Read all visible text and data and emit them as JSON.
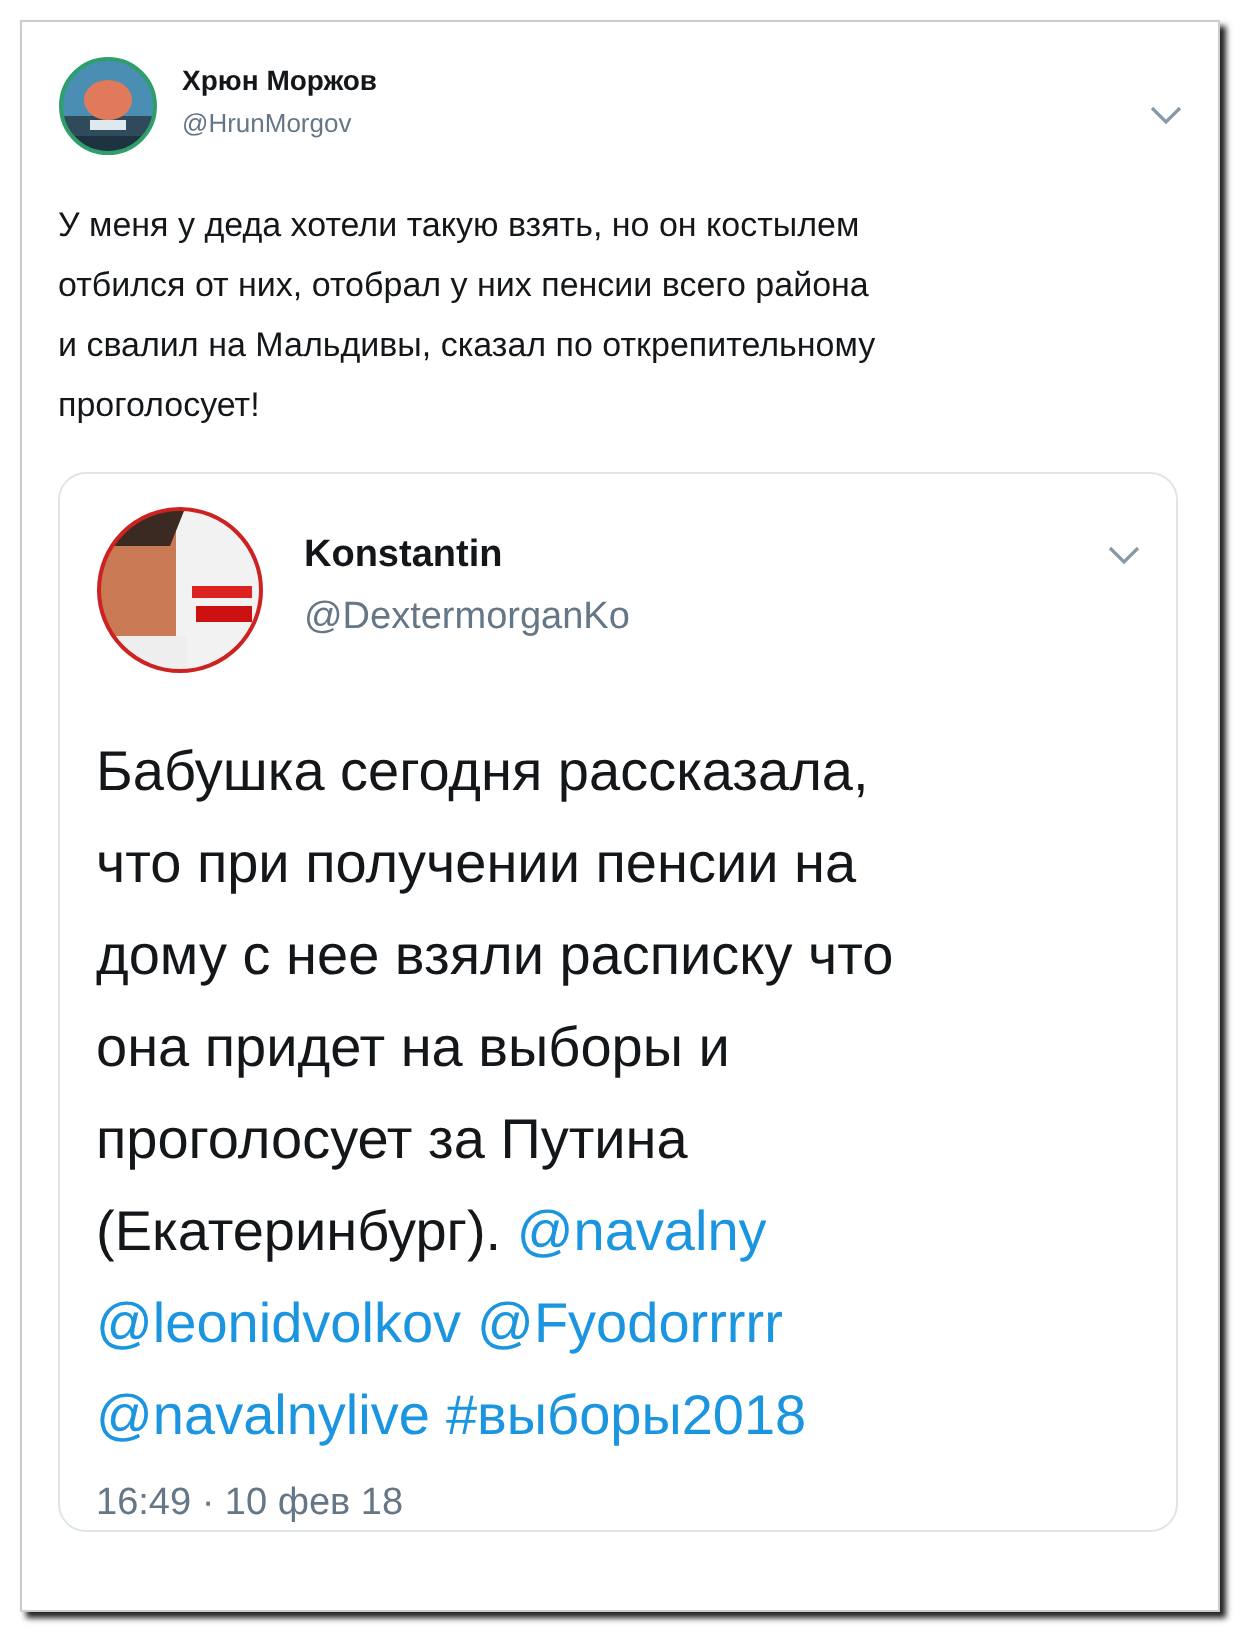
{
  "tweet": {
    "author": {
      "name": "Хрюн Моржов",
      "handle": "@HrunMorgov"
    },
    "text_lines": [
      "У меня у деда хотели такую взять, но он костылем",
      "отбился от них, отобрал у них пенсии всего района",
      "и свалил на Мальдивы, сказал по открепительному",
      "проголосует!"
    ],
    "quoted": {
      "author": {
        "name": "Konstantin",
        "handle": "@DextermorganKo"
      },
      "lines": [
        [
          {
            "kind": "text",
            "text": "Бабушка сегодня рассказала,"
          }
        ],
        [
          {
            "kind": "text",
            "text": "что при получении пенсии на"
          }
        ],
        [
          {
            "kind": "text",
            "text": "дому с нее взяли расписку что"
          }
        ],
        [
          {
            "kind": "text",
            "text": "она придет на выборы и"
          }
        ],
        [
          {
            "kind": "text",
            "text": "проголосует за Путина"
          }
        ],
        [
          {
            "kind": "text",
            "text": "(Екатеринбург). "
          },
          {
            "kind": "link",
            "text": "@navalny"
          }
        ],
        [
          {
            "kind": "link",
            "text": "@leonidvolkov"
          },
          {
            "kind": "link",
            "text": "@Fyodorrrrr"
          }
        ],
        [
          {
            "kind": "link",
            "text": "@navalnylive"
          },
          {
            "kind": "link",
            "text": "#выборы2018"
          }
        ]
      ],
      "time": "16:49 · 10 фев 18"
    }
  }
}
